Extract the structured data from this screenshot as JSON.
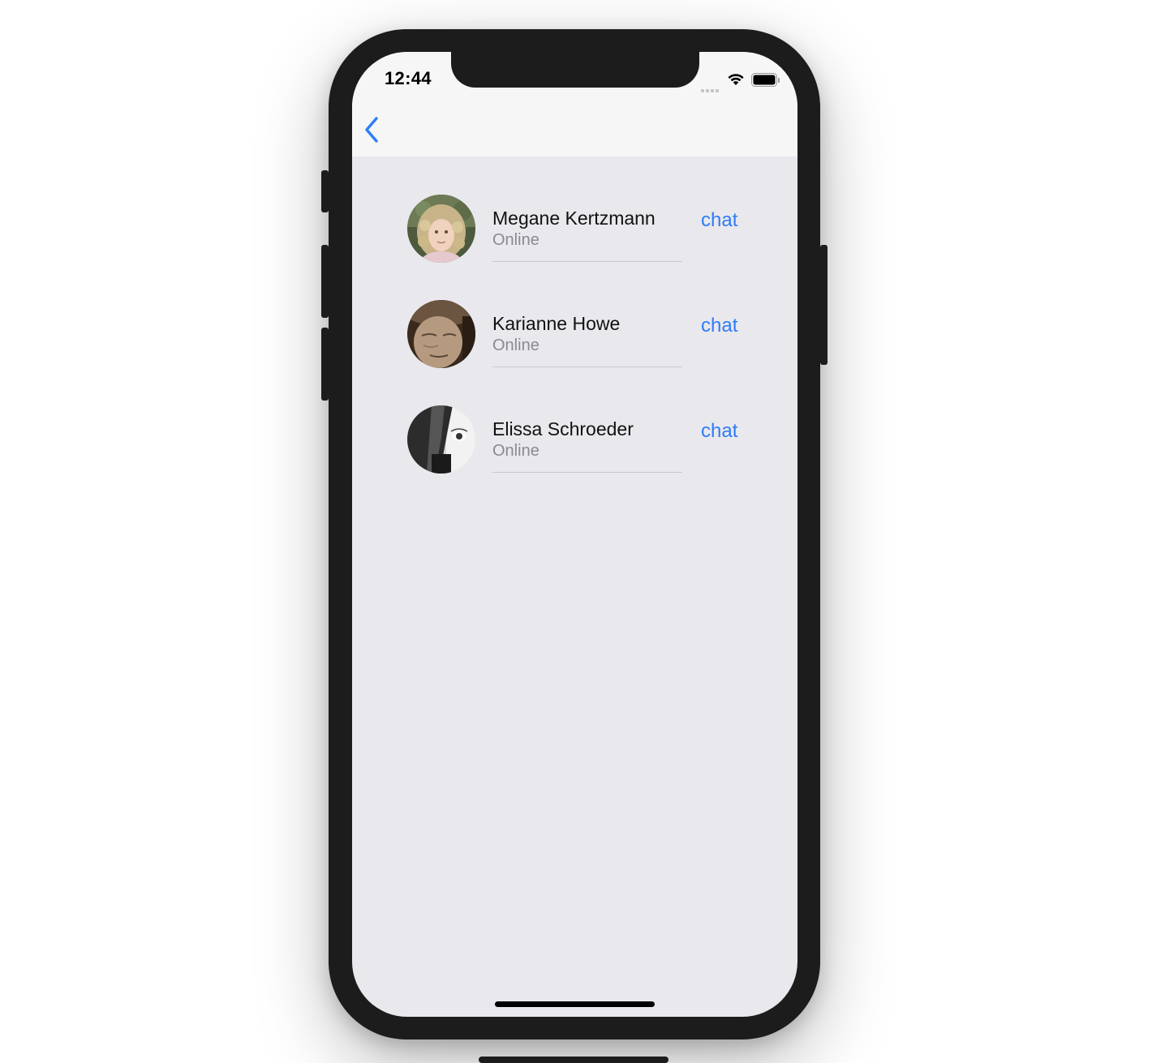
{
  "status_bar": {
    "time": "12:44"
  },
  "nav": {
    "back_icon": "chevron-left-icon"
  },
  "contacts": [
    {
      "name": "Megane Kertzmann",
      "status": "Online",
      "action": "chat"
    },
    {
      "name": "Karianne Howe",
      "status": "Online",
      "action": "chat"
    },
    {
      "name": "Elissa Schroeder",
      "status": "Online",
      "action": "chat"
    }
  ],
  "colors": {
    "accent": "#2f7cf6",
    "background": "#e9e8ed",
    "navbar": "#f6f6f7",
    "secondary_text": "#8a8a8e"
  }
}
